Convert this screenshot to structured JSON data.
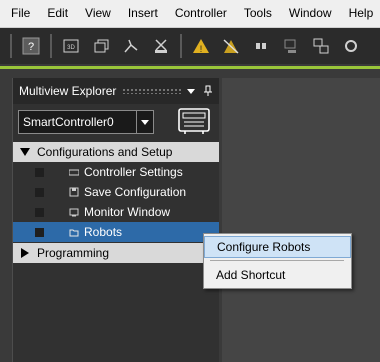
{
  "menubar": {
    "items": [
      "File",
      "Edit",
      "View",
      "Insert",
      "Controller",
      "Tools",
      "Window",
      "Help"
    ]
  },
  "toolbar": {
    "icons": [
      "help-icon",
      "3d-view-icon",
      "program-icon",
      "robot-arm-icon",
      "cut-tool-icon",
      "warning-icon",
      "clear-warnings-icon",
      "pause-icon",
      "disconnect-icon",
      "connect-icon",
      "refresh-icon"
    ]
  },
  "panel": {
    "title": "Multiview Explorer",
    "controller_select": "SmartController0",
    "groups": [
      {
        "label": "Configurations and Setup",
        "items": [
          {
            "label": "Controller Settings",
            "icon": "controller-settings-icon"
          },
          {
            "label": "Save Configuration",
            "icon": "save-icon"
          },
          {
            "label": "Monitor Window",
            "icon": "monitor-icon"
          },
          {
            "label": "Robots",
            "icon": "robots-folder-icon"
          }
        ]
      },
      {
        "label": "Programming",
        "items": []
      }
    ]
  },
  "context_menu": {
    "items": [
      "Configure Robots",
      "Add Shortcut"
    ]
  },
  "colors": {
    "accent_green": "#9ac63a",
    "selection_blue": "#2d6aa8",
    "menu_highlight": "#cfe3f6"
  }
}
